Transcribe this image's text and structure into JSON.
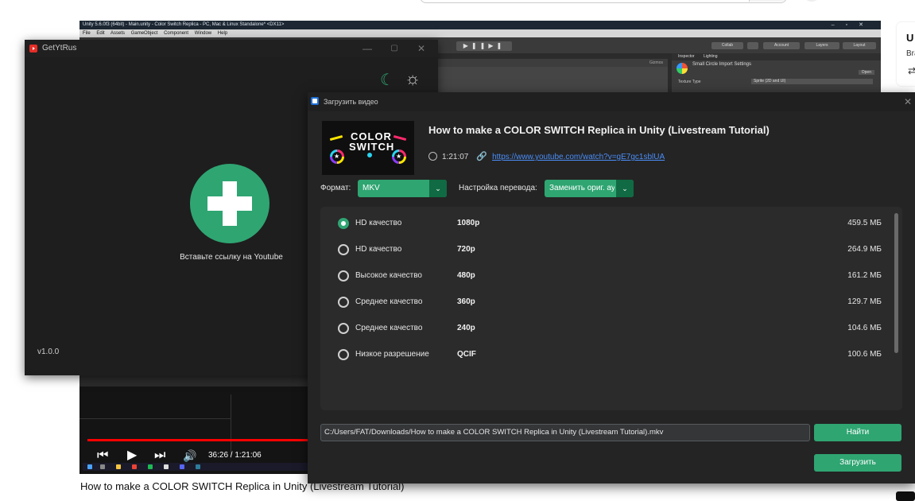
{
  "unity": {
    "title": "Unity 5.6.0f3 (64bit) - Main.unity - Color Switch Replica - PC, Mac & Linux Standalone* <DX11>",
    "menu": [
      "File",
      "Edit",
      "Assets",
      "GameObject",
      "Component",
      "Window",
      "Help"
    ],
    "toolbar": {
      "collab": "Collab",
      "account": "Account",
      "layers": "Layers",
      "layout": "Layout"
    },
    "scene_label": "Gizmos",
    "inspector": {
      "tabs": [
        "Inspector",
        "Lighting"
      ],
      "object_title": "Small Circle Import Settings",
      "open_label": "Open",
      "row_label": "Texture Type",
      "row_value": "Sprite (2D and UI)"
    }
  },
  "youtube": {
    "time_display": "36:26 / 1:21:06",
    "progress": 0.45,
    "video_title": "How to make a COLOR SWITCH Replica in Unity (Livestream Tutorial)"
  },
  "right_card": {
    "letter": "U",
    "text": "Bra"
  },
  "getytrus": {
    "title": "GetYtRus",
    "hint": "Вставьте ссылку на Youtube",
    "version": "v1.0.0"
  },
  "dialog": {
    "title": "Загрузить видео",
    "thumb_line1": "COLOR",
    "thumb_line2": "SWITCH",
    "video_title": "How to make a COLOR SWITCH Replica in Unity (Livestream Tutorial)",
    "duration": "1:21:07",
    "url": "https://www.youtube.com/watch?v=gE7gc1sblUA",
    "format_label": "Формат:",
    "format_value": "MKV",
    "translation_label": "Настройка перевода:",
    "translation_value": "Заменить ориг. аудио",
    "qualities": [
      {
        "name": "HD качество",
        "resolution": "1080p",
        "size": "459.5 МБ",
        "selected": true
      },
      {
        "name": "HD качество",
        "resolution": "720p",
        "size": "264.9 МБ",
        "selected": false
      },
      {
        "name": "Высокое качество",
        "resolution": "480p",
        "size": "161.2 МБ",
        "selected": false
      },
      {
        "name": "Среднее качество",
        "resolution": "360p",
        "size": "129.7 МБ",
        "selected": false
      },
      {
        "name": "Среднее качество",
        "resolution": "240p",
        "size": "104.6 МБ",
        "selected": false
      },
      {
        "name": "Низкое разрешение",
        "resolution": "QCIF",
        "size": "100.6 МБ",
        "selected": false
      }
    ],
    "save_path": "C:/Users/FAT/Downloads/How to make a COLOR SWITCH Replica in Unity (Livestream Tutorial).mkv",
    "find_label": "Найти",
    "download_label": "Загрузить"
  },
  "colors": {
    "accent": "#2fa572",
    "accent_dark": "#106a43",
    "link": "#4a8df8",
    "dialog_bg": "#242424"
  },
  "icons": [
    "getytrus-app-icon",
    "moon-icon",
    "sun-icon",
    "add-plus-icon",
    "dialog-app-icon",
    "clock-icon",
    "link-icon",
    "chevron-down-icon",
    "radio-icon"
  ]
}
